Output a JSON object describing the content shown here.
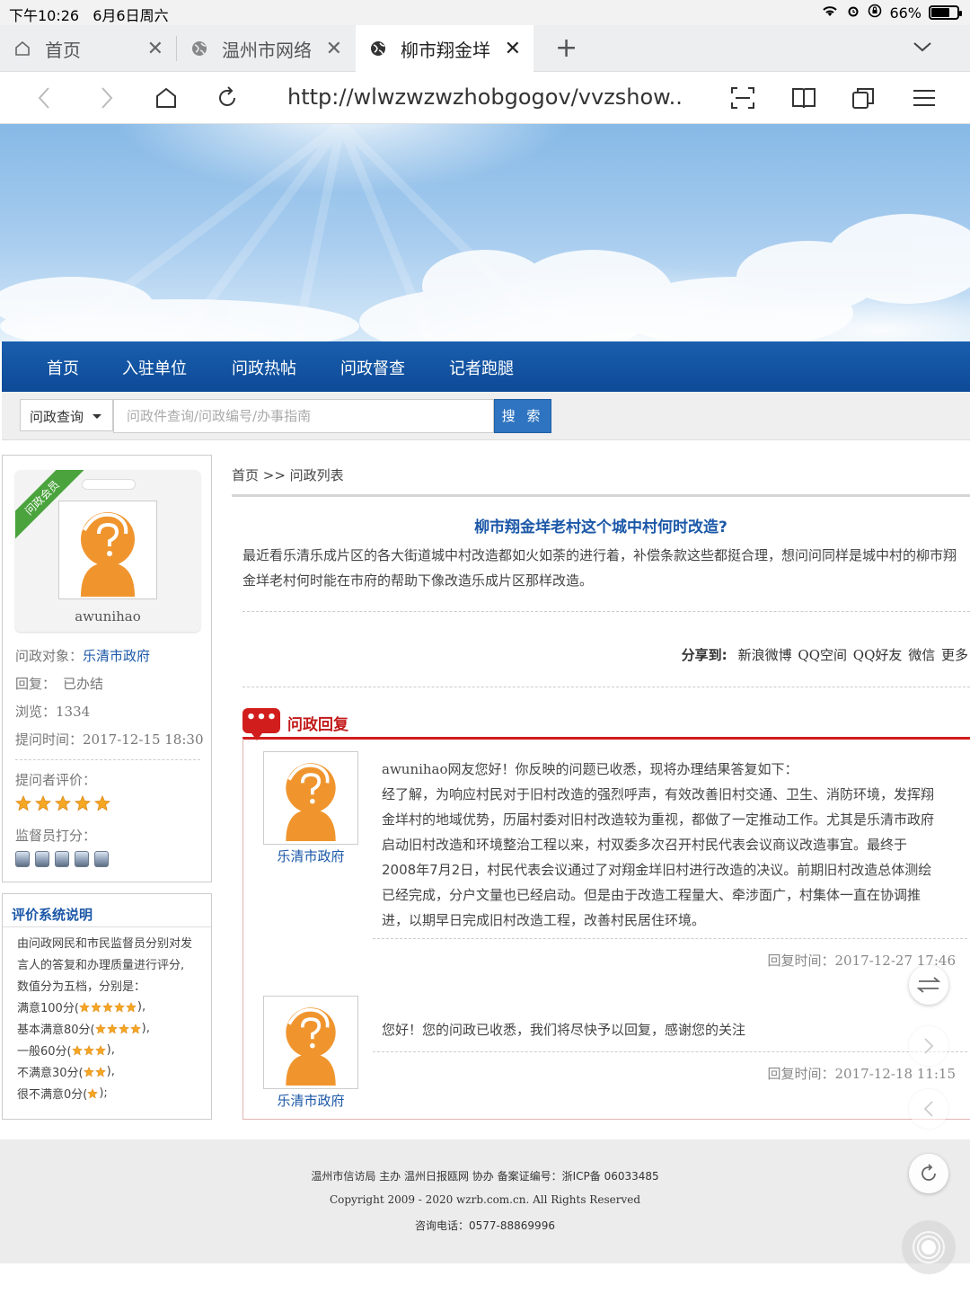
{
  "status_bar": {
    "time": "下午10:26",
    "date": "6月6日周六",
    "battery": "66%"
  },
  "tabs": [
    {
      "title": "首页"
    },
    {
      "title": "温州市网络"
    },
    {
      "title": "柳市翔金垟"
    }
  ],
  "address_bar": {
    "url": "http://wlwzwzwzhobgogov/vvzshow..."
  },
  "nav": {
    "items": [
      "首页",
      "入驻单位",
      "问政热帖",
      "问政督查",
      "记者跑腿"
    ]
  },
  "search": {
    "select_label": "问政查询",
    "placeholder": "问政件查询/问政编号/办事指南",
    "button_label": "搜 索"
  },
  "user": {
    "ribbon": "问政会员",
    "name": "awunihao",
    "target_label": "问政对象：",
    "target": "乐清市政府",
    "reply_label": "回复：",
    "reply_status": "已办结",
    "views_label": "浏览：",
    "views": "1334",
    "submit_label": "提问时间：",
    "submit_time": "2017-12-15 18:30",
    "rating_label": "提问者评价：",
    "rating_stars": 5,
    "supervisor_label": "监督员打分：",
    "supervisor_score": 5
  },
  "rating_info": {
    "title": "评价系统说明",
    "lines": [
      "由问政网民和市民监督员分别对发",
      "言人的答复和办理质量进行评分,",
      "数值分为五档，分别是："
    ],
    "levels": [
      {
        "label": "满意100分(",
        "stars": 5,
        "suffix": "),"
      },
      {
        "label": "基本满意80分(",
        "stars": 4,
        "suffix": "),"
      },
      {
        "label": "一般60分(",
        "stars": 3,
        "suffix": "),"
      },
      {
        "label": "不满意30分(",
        "stars": 2,
        "suffix": "),"
      },
      {
        "label": "很不满意0分(",
        "stars": 1,
        "suffix": ");"
      }
    ]
  },
  "breadcrumb": "首页 >> 问政列表",
  "question": {
    "title": "柳市翔金垟老村这个城中村何时改造?",
    "body": "最近看乐清乐成片区的各大街道城中村改造都如火如荼的进行着，补偿条款这些都挺合理，想问问同样是城中村的柳市翔金垟老村何时能在市府的帮助下像改造乐成片区那样改造。"
  },
  "share": {
    "label": "分享到:",
    "targets": [
      "新浪微博",
      "QQ空间",
      "QQ好友",
      "微信",
      "更多"
    ]
  },
  "replies_header": "问政回复",
  "replies": [
    {
      "org": "乐清市政府",
      "text_lead": "awunihao网友您好！你反映的问题已收悉，现将办理结果答复如下：",
      "text": "经了解，为响应村民对于旧村改造的强烈呼声，有效改善旧村交通、卫生、消防环境，发挥翔金垟村的地域优势，历届村委对旧村改造较为重视，都做了一定推动工作。尤其是乐清市政府启动旧村改造和环境整治工程以来，村双委多次召开村民代表会议商议改造事宜。最终于2008年7月2日，村民代表会议通过了对翔金垟旧村进行改造的决议。前期旧村改造总体测绘已经完成，分户文量也已经启动。但是由于改造工程量大、牵涉面广，村集体一直在协调推进，以期早日完成旧村改造工程，改善村民居住环境。",
      "time_label": "回复时间：",
      "time": "2017-12-27 17:46"
    },
    {
      "org": "乐清市政府",
      "text_lead": "",
      "text": "您好！您的问政已收悉，我们将尽快予以回复，感谢您的关注",
      "time_label": "回复时间：",
      "time": "2017-12-18 11:15"
    }
  ],
  "footer": {
    "line1": "温州市信访局 主办 温州日报瓯网 协办 备案证编号：浙ICP备 06033485",
    "line2": "Copyright 2009 - 2020 wzrb.com.cn. All Rights Reserved",
    "line3": "咨询电话：0577-88869996"
  },
  "colors": {
    "nav_blue": "#0d4a97",
    "link_blue": "#1c58a8",
    "accent_red": "#d21d1d",
    "star_orange": "#f5a623",
    "avatar_orange": "#f0952e"
  }
}
